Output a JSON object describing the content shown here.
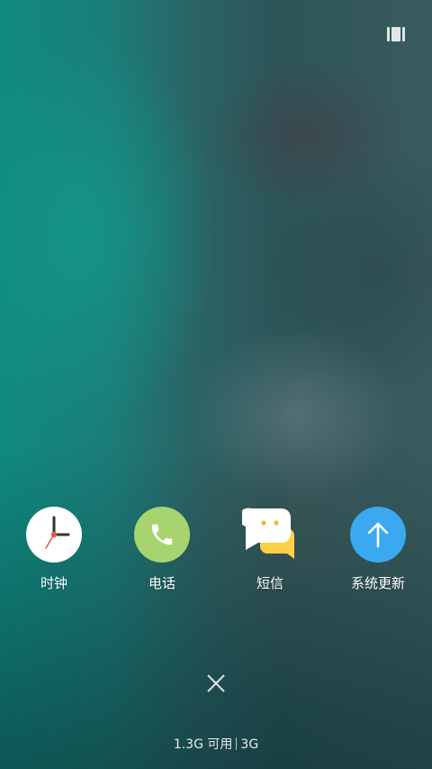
{
  "apps": [
    {
      "label": "时钟",
      "icon": "clock-icon",
      "color": "#ffffff"
    },
    {
      "label": "电话",
      "icon": "phone-icon",
      "color": "#a7d46f"
    },
    {
      "label": "短信",
      "icon": "messages-icon",
      "color": "#ffd045"
    },
    {
      "label": "系统更新",
      "icon": "arrow-up-icon",
      "color": "#3aa9f0"
    }
  ],
  "memory": {
    "available": "1.3G 可用",
    "total": "3G"
  },
  "icons": {
    "recents_toggle": "view-toggle-icon",
    "close": "close-icon"
  }
}
